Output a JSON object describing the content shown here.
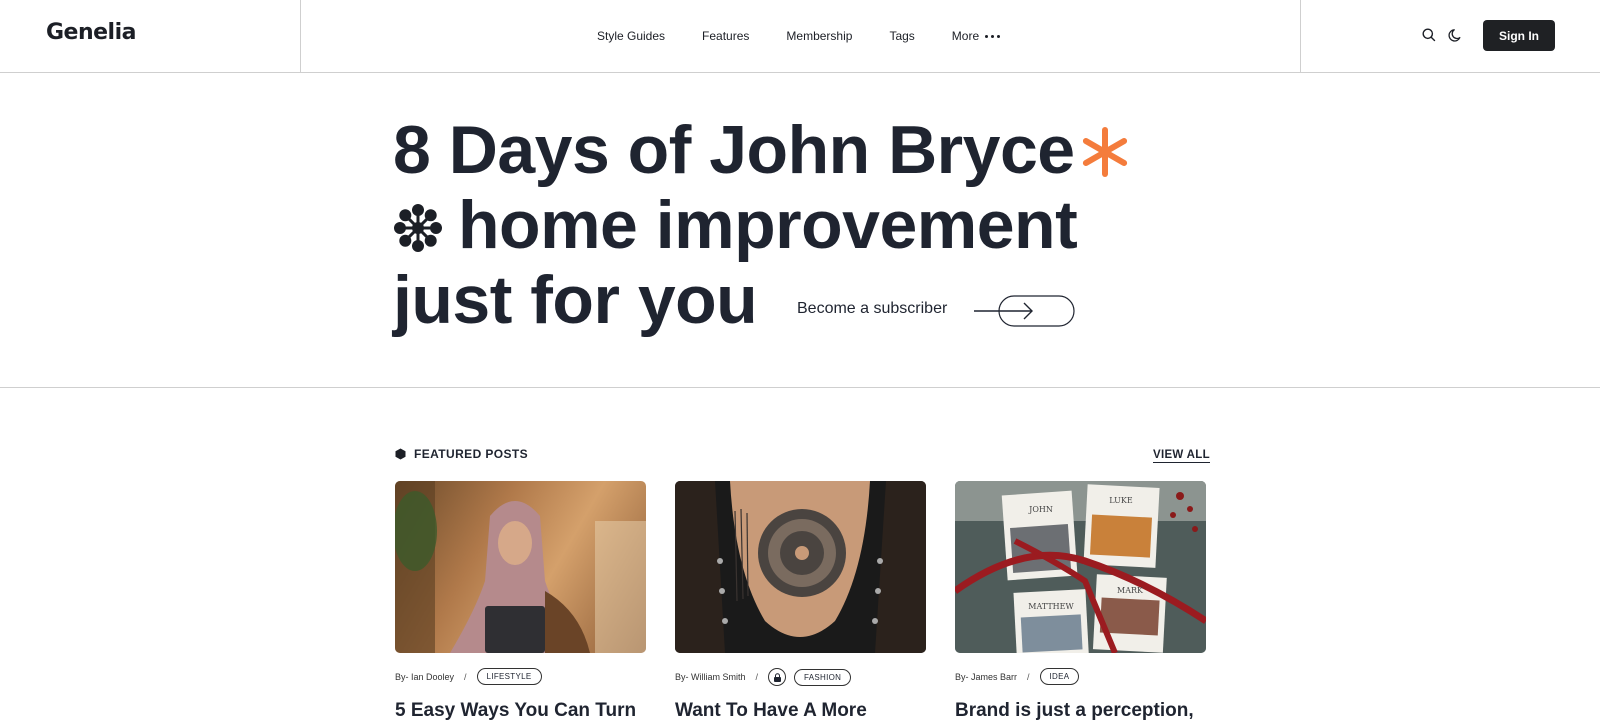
{
  "header": {
    "logo": "Genelia",
    "nav": [
      {
        "label": "Style Guides"
      },
      {
        "label": "Features"
      },
      {
        "label": "Membership"
      },
      {
        "label": "Tags"
      },
      {
        "label": "More"
      }
    ],
    "sign_in": "Sign In",
    "icons": [
      "search-icon",
      "moon-icon"
    ]
  },
  "hero": {
    "line1": "8 Days of John Bryce",
    "line2": "home improvement",
    "line3": "just for you",
    "cta": "Become a subscriber",
    "accent_color": "#f47c3c"
  },
  "featured": {
    "title": "FEATURED POSTS",
    "view_all": "VIEW ALL",
    "cards": [
      {
        "author": "By- Ian Dooley",
        "tag": "LIFESTYLE",
        "title": "5 Easy Ways You Can Turn",
        "locked": false
      },
      {
        "author": "By- William Smith",
        "tag": "FASHION",
        "title": "Want To Have A More",
        "locked": true
      },
      {
        "author": "By- James Barr",
        "tag": "IDEA",
        "title": "Brand is just a perception,",
        "locked": false
      }
    ]
  },
  "image_text": {
    "book1": "JOHN",
    "book2": "LUKE",
    "book3": "MATTHEW",
    "book4": "MARK"
  }
}
